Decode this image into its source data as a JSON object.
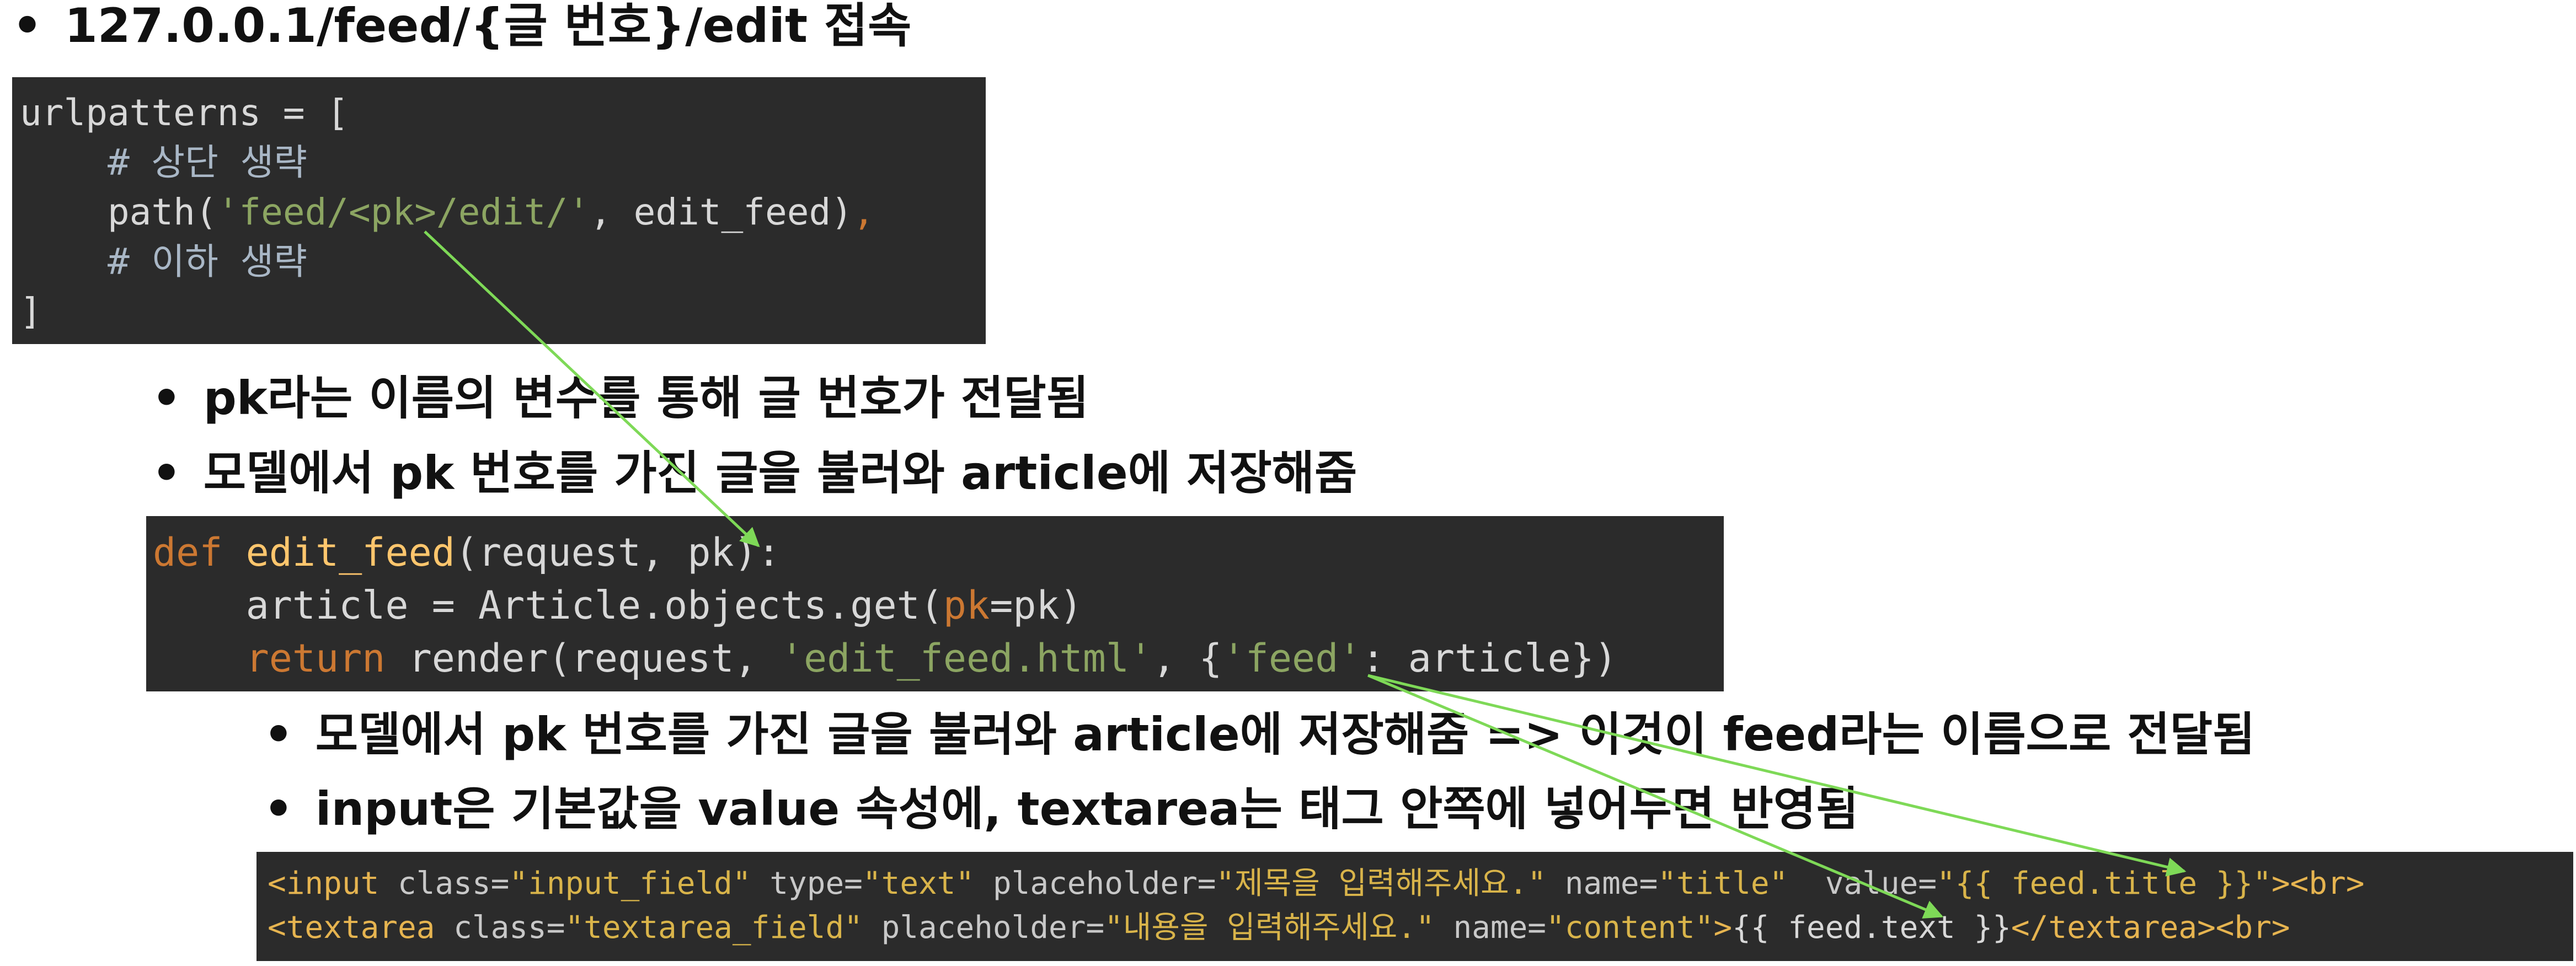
{
  "heading": "127.0.0.1/feed/{글 번호}/edit 접속",
  "bullet_symbol": "•",
  "urls_code": {
    "l1": "urlpatterns = [",
    "l2": "    # 상단 생략",
    "l3_a": "    path(",
    "l3_str": "'feed/<pk>/edit/'",
    "l3_b": ", edit_feed)",
    "l3_comma": ",",
    "l4": "    # 이하 생략",
    "l5": "]"
  },
  "bullet_pk": "pk라는 이름의 변수를 통해 글 번호가 전달됨",
  "bullet_model": "모델에서 pk 번호를 가진 글을 불러와 article에 저장해줌",
  "view_code": {
    "def": "def",
    "fn": "edit_feed",
    "params": "(request, pk):",
    "l2_a": "    article = Article.objects.get(",
    "l2_kw": "pk",
    "l2_b": "=pk)",
    "ret": "    return",
    "l3_a": " render(request, ",
    "l3_str1": "'edit_feed.html'",
    "l3_b": ", {",
    "l3_str2": "'feed'",
    "l3_c": ": article})"
  },
  "bullet_feed": "모델에서 pk 번호를 가진 글을 불러와 article에 저장해줌 => 이것이 feed라는 이름으로 전달됨",
  "bullet_input": "input은 기본값을 value 속성에, textarea는 태그 안쪽에 넣어두면 반영됨",
  "html_code": {
    "l1_tag1": "<input",
    "l1_a1": " class=",
    "l1_v1": "\"input_field\"",
    "l1_a2": " type=",
    "l1_v2": "\"text\"",
    "l1_a3": " placeholder=",
    "l1_v3": "\"제목을 입력해주세요.\"",
    "l1_a4": " name=",
    "l1_v4": "\"title\"",
    "l1_a5": "  value=",
    "l1_v5": "\"{{ feed.title }}\"",
    "l1_tag2": "><br>",
    "l2_tag1": "<textarea",
    "l2_a1": " class=",
    "l2_v1": "\"textarea_field\"",
    "l2_a2": " placeholder=",
    "l2_v2": "\"내용을 입력해주세요.\"",
    "l2_a3": " name=",
    "l2_v3": "\"content\"",
    "l2_tag2": ">",
    "l2_txt": "{{ feed.text }}",
    "l2_tag3": "</textarea><br>"
  },
  "colors": {
    "code_bg": "#2b2b2b",
    "arrow": "#7ed957",
    "keyword": "#cc7832",
    "function": "#ffc66d",
    "string": "#8ca562"
  }
}
